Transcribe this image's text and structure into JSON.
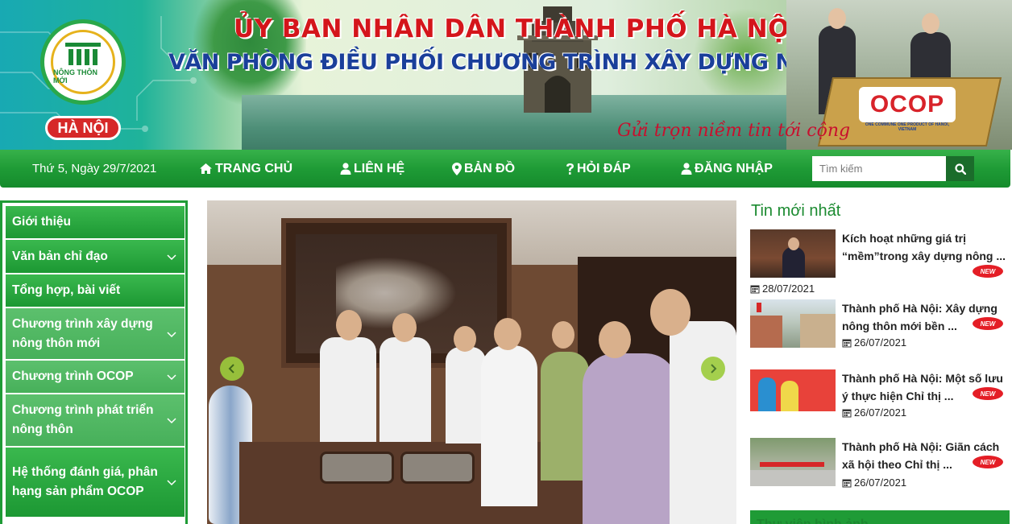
{
  "banner": {
    "org_title": "ỦY BAN NHÂN DÂN THÀNH PHỐ HÀ NỘI",
    "office_title": "VĂN PHÒNG ĐIỀU PHỐI CHƯƠNG TRÌNH XÂY DỰNG NÔNG THÔN MỚI",
    "slogan": "Gửi trọn niềm tin tới cộng",
    "logo_arc_text": "NÔNG THÔN MỚI",
    "logo_place": "HÀ NỘI",
    "ocop_logo": "OCOP",
    "ocop_tagline": "ONE COMMUNE ONE PRODUCT OF HANOI, VIETNAM"
  },
  "nav": {
    "date": "Thứ 5, Ngày 29/7/2021",
    "items": [
      {
        "label": "TRANG CHỦ",
        "icon": "home-icon"
      },
      {
        "label": "LIÊN HỆ",
        "icon": "user-icon"
      },
      {
        "label": "BẢN ĐỒ",
        "icon": "map-marker-icon"
      },
      {
        "label": "HỎI ĐÁP",
        "icon": "question-icon"
      },
      {
        "label": "ĐĂNG NHẬP",
        "icon": "user-icon"
      }
    ],
    "search_placeholder": "Tìm kiếm"
  },
  "sidebar": {
    "items": [
      {
        "label": "Giới thiệu",
        "has_children": false
      },
      {
        "label": "Văn bản chỉ đạo",
        "has_children": true
      },
      {
        "label": "Tổng hợp, bài viết",
        "has_children": false
      },
      {
        "label": "Chương trình xây dựng nông thôn mới",
        "has_children": true
      },
      {
        "label": "Chương trình OCOP",
        "has_children": true
      },
      {
        "label": "Chương trình phát triển nông thôn",
        "has_children": true
      },
      {
        "label": "Hệ thống đánh giá, phân hạng sản phẩm OCOP",
        "has_children": true
      }
    ]
  },
  "news": {
    "heading": "Tin mới nhất",
    "badge": "NEW",
    "items": [
      {
        "title": "Kích hoạt những giá trị “mềm”trong xây dựng nông ...",
        "date": "28/07/2021"
      },
      {
        "title": "Thành phố Hà Nội: Xây dựng nông thôn mới bền ...",
        "date": "26/07/2021"
      },
      {
        "title": "Thành phố Hà Nội: Một số lưu ý thực hiện Chỉ thị ...",
        "date": "26/07/2021"
      },
      {
        "title": "Thành phố Hà Nội: Giãn cách xã hội theo Chỉ thị ...",
        "date": "26/07/2021"
      }
    ],
    "next_box_title": "Thư viện hình ảnh"
  },
  "colors": {
    "brand_green": "#1f9b36",
    "title_red": "#d4151b",
    "title_blue": "#1a3f9a",
    "badge_red": "#e41e26"
  }
}
